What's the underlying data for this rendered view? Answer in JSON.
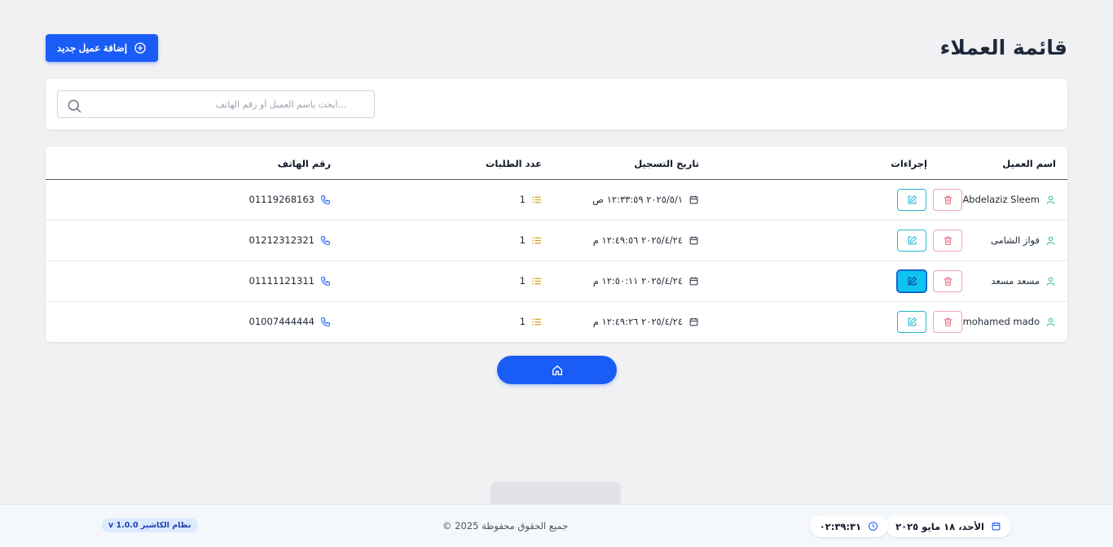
{
  "header": {
    "title": "قائمة العملاء",
    "add_button_label": "إضافة عميل جديد"
  },
  "search": {
    "placeholder": "...ابحث باسم العميل أو رقم الهاتف",
    "value": ""
  },
  "table": {
    "columns": {
      "name": "اسم العميل",
      "phone": "رقم الهاتف",
      "orders": "عدد الطلبات",
      "date": "تاريخ التسجيل",
      "actions": "إجراءات"
    },
    "rows": [
      {
        "name": "Abdelaziz Sleem",
        "phone": "01119268163",
        "orders": "1",
        "date": "٢٠٢٥/٥/١ ١٢:٣٣:٥٩ ص",
        "edit_active": false
      },
      {
        "name": "فواز الشامى",
        "phone": "01212312321",
        "orders": "1",
        "date": "٢٠٢٥/٤/٢٤ ١٢:٤٩:٥٦ م",
        "edit_active": false
      },
      {
        "name": "مسعد مسعد",
        "phone": "01111121311",
        "orders": "1",
        "date": "٢٠٢٥/٤/٢٤ ١٢:٥٠:١١ م",
        "edit_active": true
      },
      {
        "name": "mohamed mado",
        "phone": "01007444444",
        "orders": "1",
        "date": "٢٠٢٥/٤/٢٤ ١٢:٤٩:٢٦ م",
        "edit_active": false
      }
    ]
  },
  "footer": {
    "date": "الأحد، ١٨ مايو ٢٠٢٥",
    "time": "٠٢:٣٩:٣١",
    "copyright": "جميع الحقوق محفوظة 2025 ©",
    "version": "نظام الكاشير v 1.0.0"
  },
  "colors": {
    "primary": "#1a5cf6",
    "user_icon": "#34c38f",
    "phone_icon": "#1a5cf6",
    "orders_icon": "#d4a017",
    "edit_border": "#22b8cf",
    "delete_border": "#f0a6b0",
    "delete_icon": "#e57383"
  },
  "icons": {
    "add": "plus-circle-icon",
    "search": "search-icon",
    "user": "user-icon",
    "phone": "phone-icon",
    "orders": "list-icon",
    "date": "calendar-icon",
    "edit": "edit-icon",
    "delete": "trash-icon",
    "home": "home-icon",
    "clock": "clock-icon"
  }
}
